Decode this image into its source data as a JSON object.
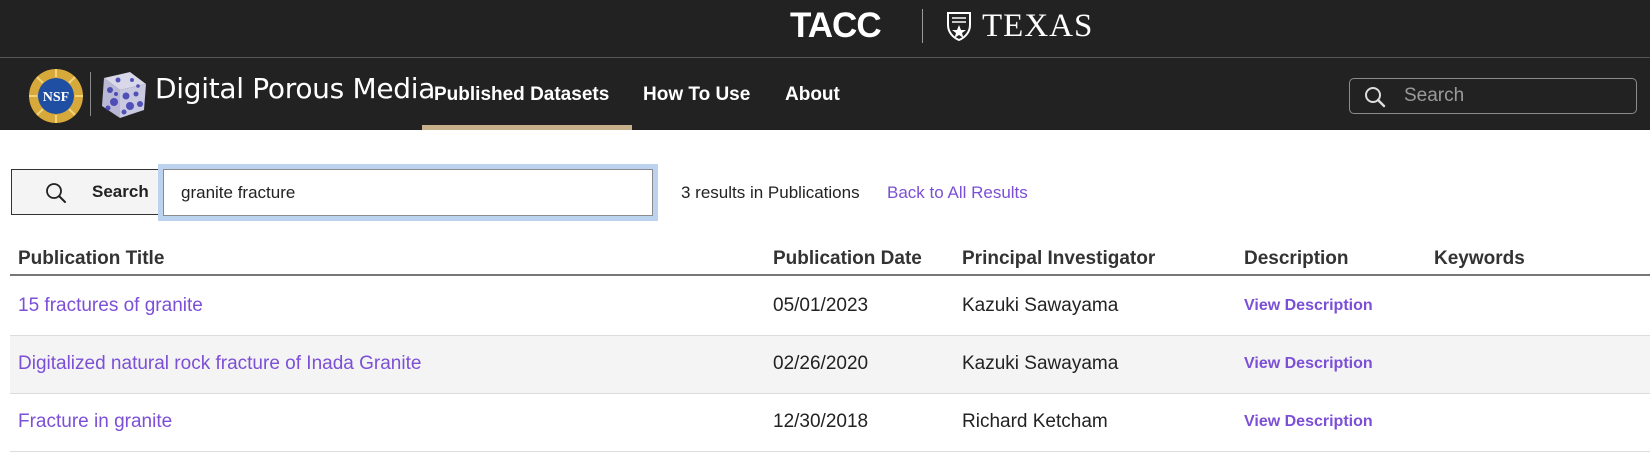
{
  "banner": {
    "tacc_logo": "TACC",
    "texas_logo": "TEXAS"
  },
  "nav": {
    "nsf_logo": "NSF",
    "site_title": "Digital Porous Media",
    "links": [
      {
        "label": "Published Datasets",
        "active": true
      },
      {
        "label": "How To Use"
      },
      {
        "label": "About"
      }
    ],
    "search_placeholder": "Search"
  },
  "search": {
    "button_label": "Search",
    "query": "granite fracture",
    "result_count_text": "3 results in Publications",
    "back_link": "Back to All Results"
  },
  "table": {
    "columns": [
      "Publication Title",
      "Publication Date",
      "Principal Investigator",
      "Description",
      "Keywords"
    ],
    "rows": [
      {
        "title": "15 fractures of granite",
        "date": "05/01/2023",
        "pi": "Kazuki Sawayama",
        "description": "View Description",
        "keywords": ""
      },
      {
        "title": "Digitalized natural rock fracture of Inada Granite",
        "date": "02/26/2020",
        "pi": "Kazuki Sawayama",
        "description": "View Description",
        "keywords": ""
      },
      {
        "title": "Fracture in granite",
        "date": "12/30/2018",
        "pi": "Richard Ketcham",
        "description": "View Description",
        "keywords": ""
      }
    ]
  },
  "colors": {
    "banner_bg": "#222222",
    "link_purple": "#7b4fd6",
    "active_underline": "#c8b08a",
    "focus_ring": "#bcd3f0"
  }
}
